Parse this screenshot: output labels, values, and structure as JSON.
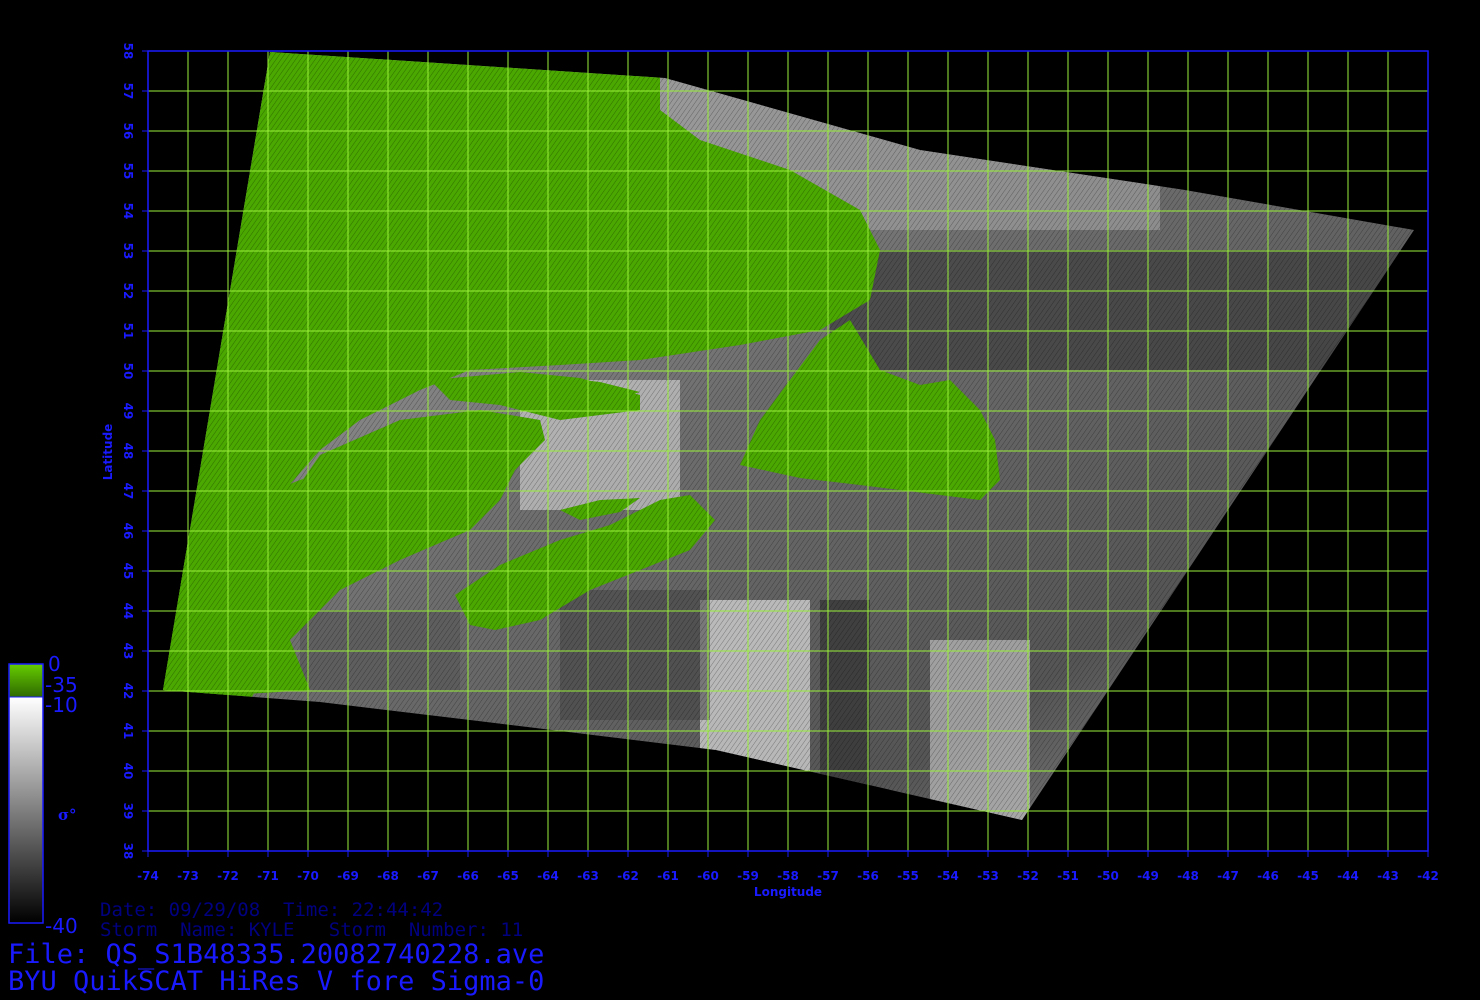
{
  "figure": {
    "axes": {
      "xlabel": "Longitude",
      "ylabel": "Latitude",
      "lon_range": [
        -74,
        -42
      ],
      "lat_range": [
        38,
        58
      ],
      "lon_ticks": [
        "-74",
        "-73",
        "-72",
        "-71",
        "-70",
        "-69",
        "-68",
        "-67",
        "-66",
        "-65",
        "-64",
        "-63",
        "-62",
        "-61",
        "-60",
        "-59",
        "-58",
        "-57",
        "-56",
        "-55",
        "-54",
        "-53",
        "-52",
        "-51",
        "-50",
        "-49",
        "-48",
        "-47",
        "-46",
        "-45",
        "-44",
        "-43",
        "-42"
      ],
      "lat_ticks": [
        "38",
        "39",
        "40",
        "41",
        "42",
        "43",
        "44",
        "45",
        "46",
        "47",
        "48",
        "49",
        "50",
        "51",
        "52",
        "53",
        "54",
        "55",
        "56",
        "57",
        "58"
      ],
      "grid": true
    },
    "colorbar": {
      "label": "σ°",
      "labels": [
        "0",
        "-35",
        "-10",
        "-40"
      ],
      "land_color": "#4aa800",
      "ocean_colors": [
        "#ffffff",
        "#000000"
      ]
    },
    "colors": {
      "grid": "#9aef3a",
      "axis": "#1a1aff",
      "background": "#000000"
    }
  },
  "info": {
    "date_line": "Date: 09/29/08  Time: 22:44:42",
    "storm_line": "Storm  Name: KYLE   Storm  Number: 11",
    "file_line": "File: QS_S1B48335.20082740228.ave",
    "product_line": "BYU QuikSCAT HiRes V fore Sigma-0"
  }
}
